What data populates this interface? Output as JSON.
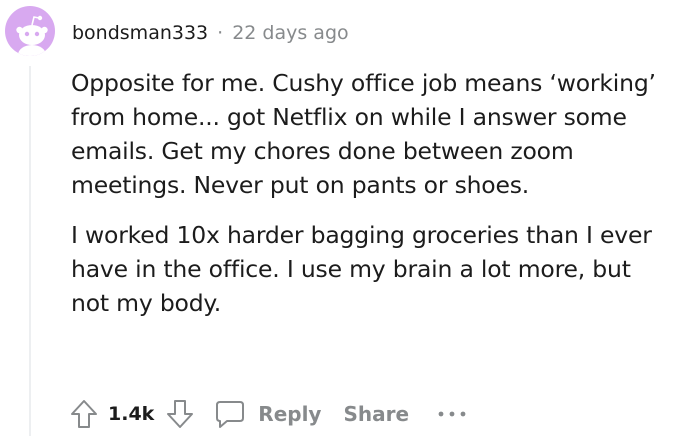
{
  "comment": {
    "author": "bondsman333",
    "separator": "·",
    "timestamp": "22 days ago",
    "paragraphs": [
      {
        "lines": [
          "Opposite for me. Cushy office job means ‘working’",
          "from home... got Netflix on while I answer some",
          "emails. Get my chores done between zoom",
          "meetings. Never put on pants or shoes."
        ]
      },
      {
        "lines": [
          "I worked 10x harder bagging groceries than I ever",
          "have in the office. I use my brain a lot more, but",
          "not my body."
        ]
      }
    ]
  },
  "actions": {
    "upvote_icon": "arrow-up-icon",
    "score": "1.4k",
    "downvote_icon": "arrow-down-icon",
    "reply_icon": "comment-bubble-icon",
    "reply_label": "Reply",
    "share_label": "Share",
    "more_icon": "ellipsis-icon"
  },
  "colors": {
    "avatar_bg": "#d8a9f0",
    "muted_text": "#878a8c",
    "body_text": "#1c1c1c"
  }
}
